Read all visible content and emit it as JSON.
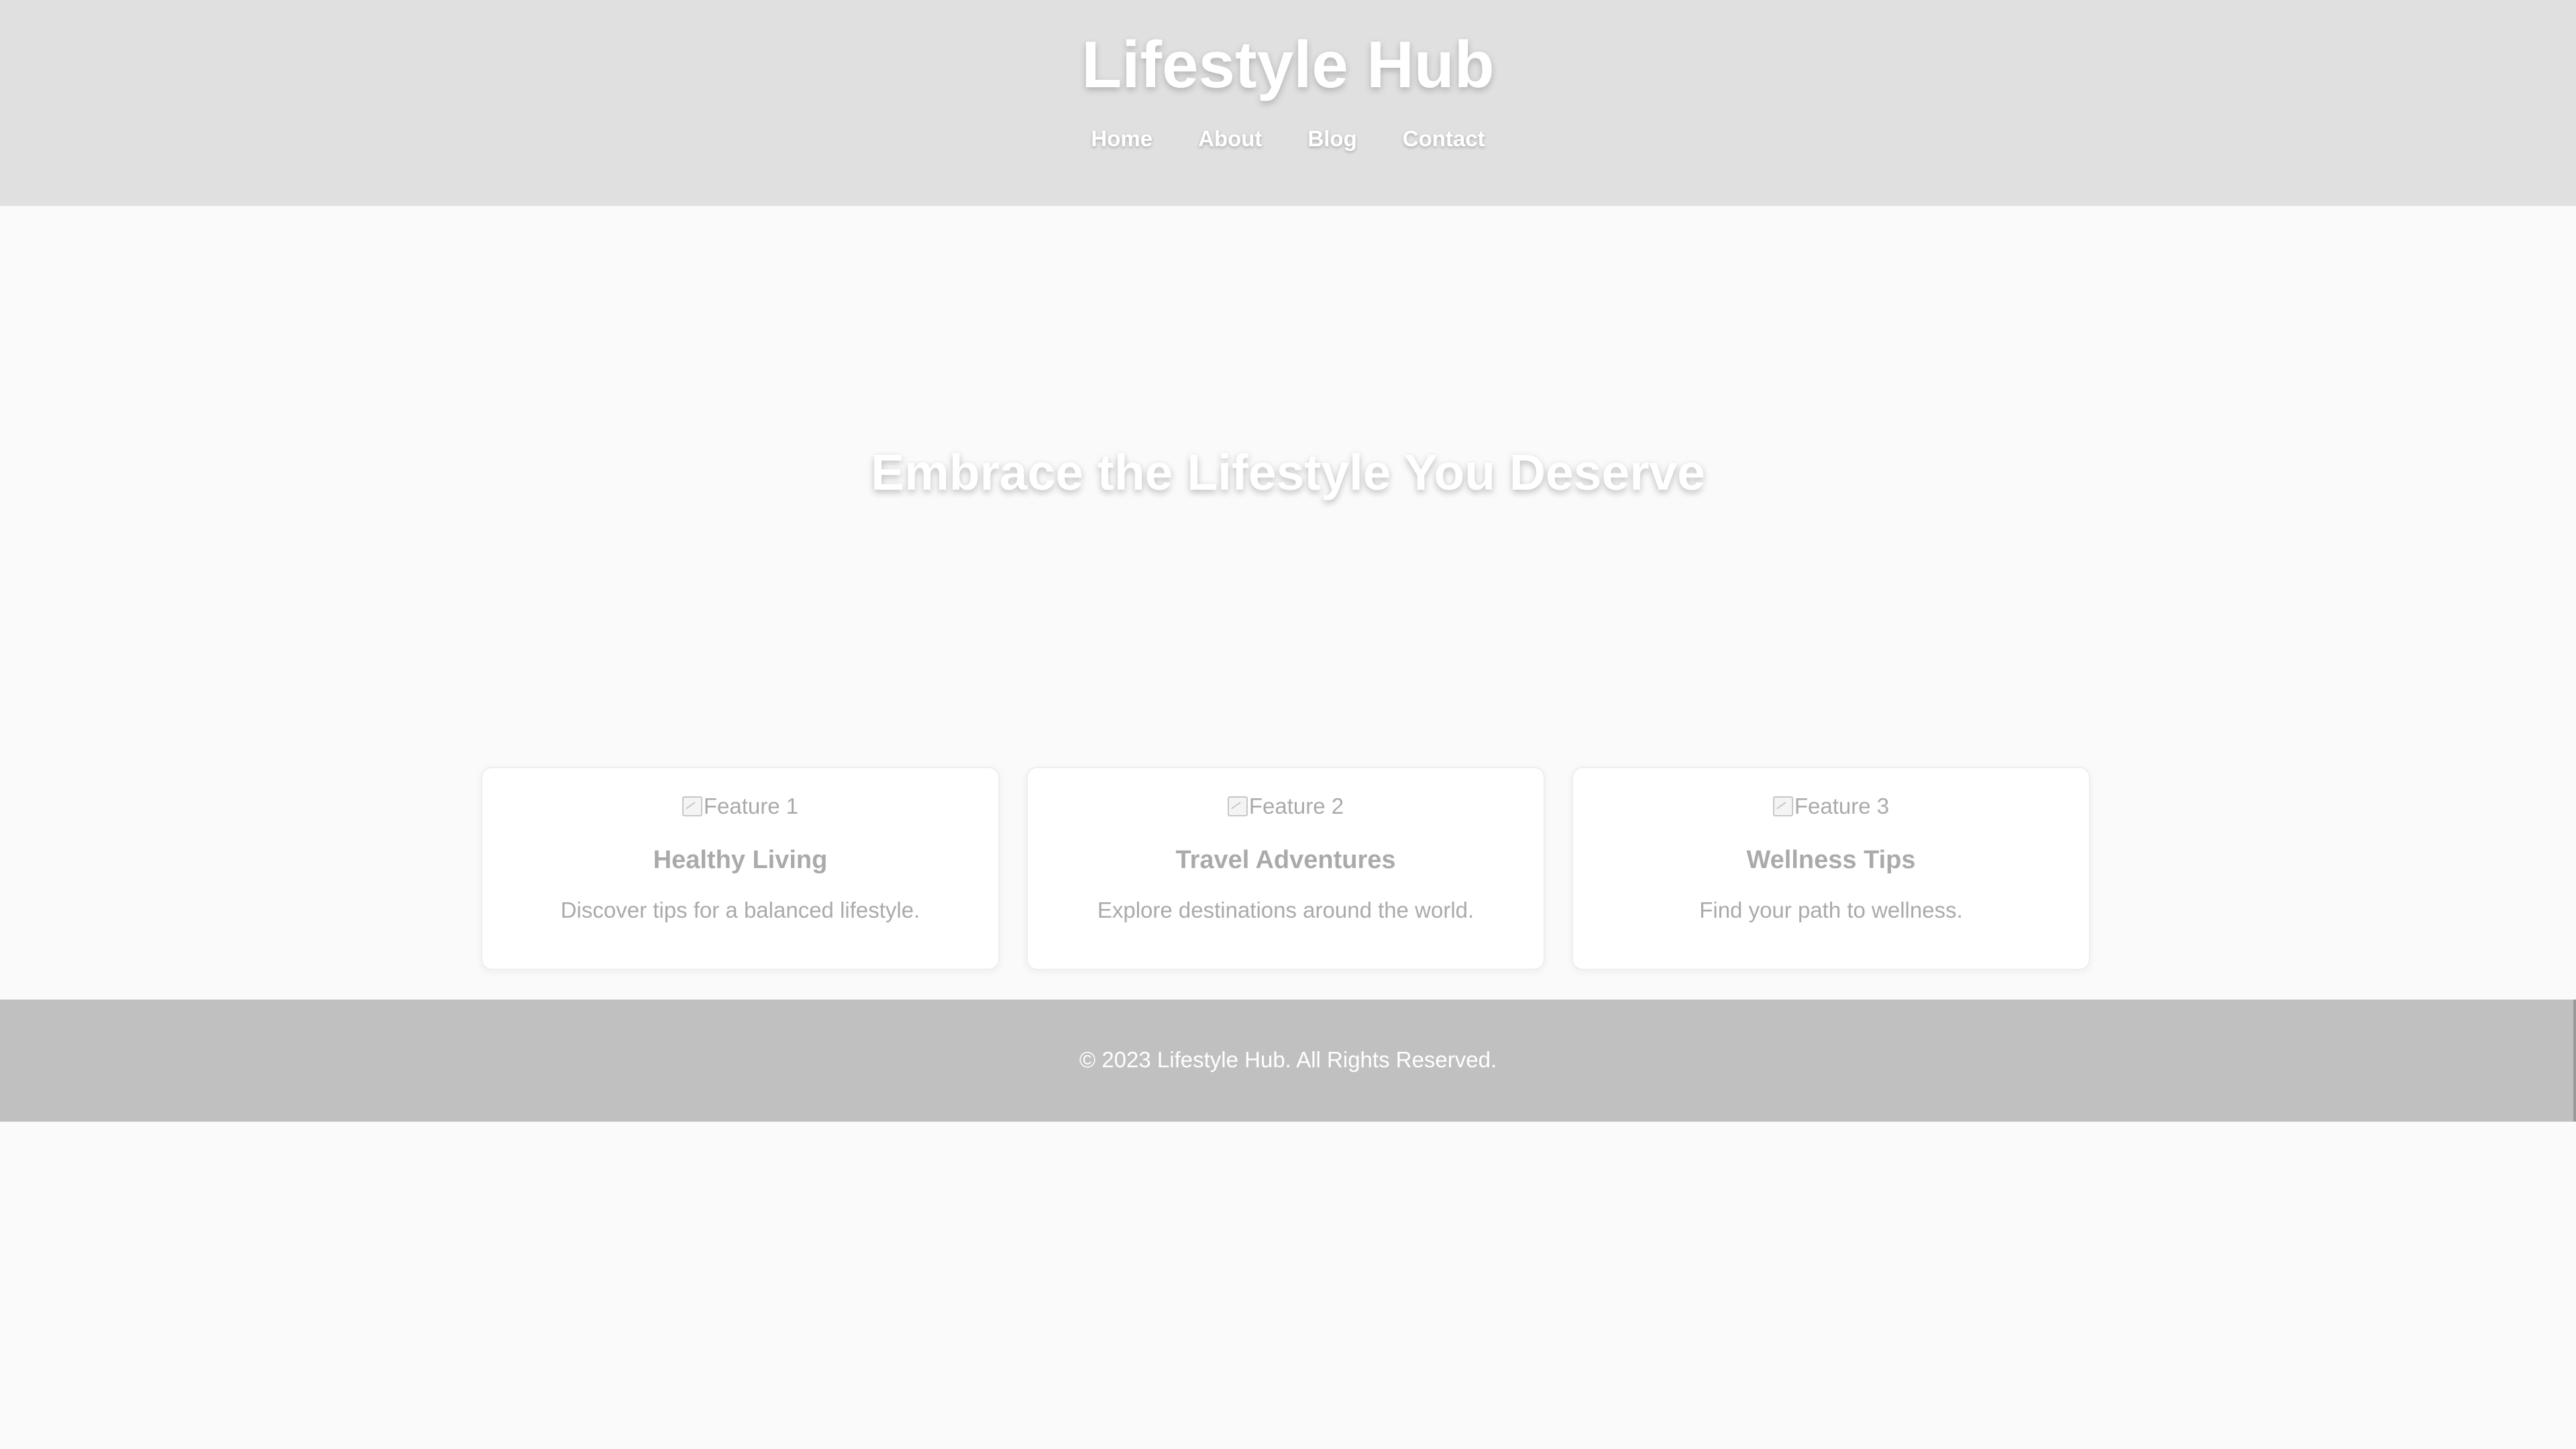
{
  "header": {
    "site_title": "Lifestyle Hub",
    "nav": [
      "Home",
      "About",
      "Blog",
      "Contact"
    ]
  },
  "hero": {
    "title": "Embrace the Lifestyle You Deserve"
  },
  "features": [
    {
      "image_alt": "Feature 1",
      "title": "Healthy Living",
      "text": "Discover tips for a balanced lifestyle."
    },
    {
      "image_alt": "Feature 2",
      "title": "Travel Adventures",
      "text": "Explore destinations around the world."
    },
    {
      "image_alt": "Feature 3",
      "title": "Wellness Tips",
      "text": "Find your path to wellness."
    }
  ],
  "footer": {
    "text": "© 2023 Lifestyle Hub. All Rights Reserved."
  },
  "colors": {
    "header_bg": "#e0e0e0",
    "page_bg": "#fafafa",
    "card_bg": "#ffffff",
    "card_text": "#aaaaaa",
    "footer_bg": "#c0c0c0",
    "header_text": "#ffffff"
  }
}
